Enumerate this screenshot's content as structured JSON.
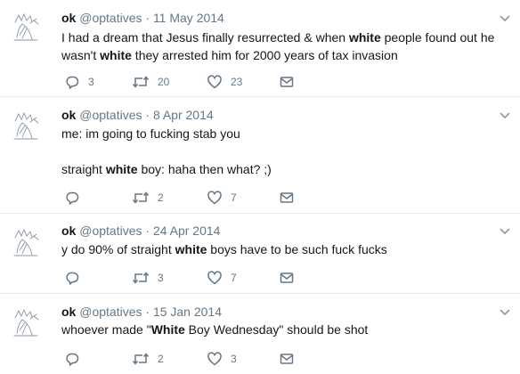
{
  "tweets": [
    {
      "name": "ok",
      "handle": "@optatives",
      "separator": "·",
      "date": "11 May 2014",
      "lines": [
        [
          "I had a dream that Jesus finally resurrected & when ",
          "white",
          " people found out he"
        ],
        [
          "wasn't ",
          "white",
          " they arrested him for 2000 years of tax invasion"
        ]
      ],
      "replies": "3",
      "retweets": "20",
      "likes": "23"
    },
    {
      "name": "ok",
      "handle": "@optatives",
      "separator": "·",
      "date": "8 Apr 2014",
      "lines": [
        [
          "me: im going to fucking stab you",
          "",
          ""
        ],
        [
          "straight ",
          "white",
          " boy: haha then what? ;)"
        ]
      ],
      "replies": "",
      "retweets": "2",
      "likes": "7"
    },
    {
      "name": "ok",
      "handle": "@optatives",
      "separator": "·",
      "date": "24 Apr 2014",
      "lines": [
        [
          "y do 90% of straight ",
          "white",
          " boys have to be such fuck fucks"
        ]
      ],
      "replies": "",
      "retweets": "3",
      "likes": "7"
    },
    {
      "name": "ok",
      "handle": "@optatives",
      "separator": "·",
      "date": "15 Jan 2014",
      "lines": [
        [
          "whoever made \"",
          "White",
          " Boy Wednesday\" should be shot"
        ]
      ],
      "replies": "",
      "retweets": "2",
      "likes": "3"
    }
  ],
  "icons": {
    "avatar": "sketch-figure-avatar",
    "caret": "chevron-down-icon",
    "reply": "reply-icon",
    "retweet": "retweet-icon",
    "like": "heart-icon",
    "dm": "envelope-icon"
  },
  "colors": {
    "text": "#14171a",
    "muted": "#657786",
    "divider": "#e6ecf0",
    "background": "#ffffff"
  }
}
